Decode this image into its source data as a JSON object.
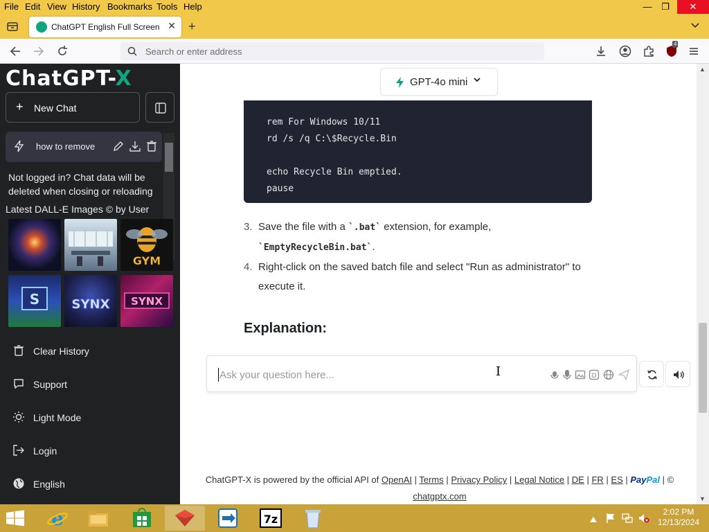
{
  "menubar": {
    "items": [
      "File",
      "Edit",
      "View",
      "History",
      "Bookmarks",
      "Tools",
      "Help"
    ],
    "window_controls": {
      "minimize": "—",
      "restore": "❐",
      "close": "✕"
    }
  },
  "tabbar": {
    "active_tab_title": "ChatGPT English Full Screen | X",
    "new_tab_label": "+"
  },
  "navbar": {
    "address_placeholder": "Search or enter address",
    "extension_badge": "4"
  },
  "sidebar": {
    "logo_main": "ChatGPT-",
    "logo_accent": "X",
    "new_chat_label": "New Chat",
    "chat_items": [
      {
        "title": "how to remove"
      }
    ],
    "notice": "Not logged in? Chat data will be deleted when closing or reloading",
    "dalle_title": "Latest DALL-E Images © by User",
    "images": [
      "planet-explosion",
      "gym-interior",
      "gym-bee-logo",
      "synx-logo-1",
      "synx-logo-2",
      "synx-banner"
    ],
    "gym_text": "GYM",
    "synx_text": "SYNX",
    "links": [
      {
        "label": "Clear History",
        "icon": "trash-icon"
      },
      {
        "label": "Support",
        "icon": "chat-bubble-icon"
      },
      {
        "label": "Light Mode",
        "icon": "sun-icon"
      },
      {
        "label": "Login",
        "icon": "login-icon"
      },
      {
        "label": "English",
        "icon": "globe-icon"
      }
    ]
  },
  "main": {
    "model_label": "GPT-4o mini",
    "code_lines": "rem For Windows 10/11\nrd /s /q C:\\$Recycle.Bin\n\necho Recycle Bin emptied.\npause",
    "steps": [
      {
        "num": "3.",
        "pre": "Save the file with a ",
        "code1": "`.bat`",
        "mid": " extension, for example, ",
        "code2": "`EmptyRecycleBin.bat`",
        "post": "."
      },
      {
        "num": "4.",
        "text": "Right-click on the saved batch file and select \"Run as administrator\" to execute it."
      }
    ],
    "heading": "Explanation:",
    "input_placeholder": "Ask your question here..."
  },
  "footer": {
    "prefix": "ChatGPT-X is powered by the official API of ",
    "links": [
      "OpenAI",
      "Terms",
      "Privacy Policy",
      "Legal Notice",
      "DE",
      "FR",
      "ES"
    ],
    "separator": " | ",
    "paypal_a": "Pay",
    "paypal_b": "Pal",
    "copyright": " | ©",
    "domain": "chatgptx.com"
  },
  "taskbar": {
    "apps": [
      "internet-explorer",
      "file-explorer",
      "store",
      "app-red",
      "file-transfer",
      "7-zip",
      "recycle-bin"
    ],
    "seven_zip_label": "7z",
    "time": "2:02 PM",
    "date": "12/13/2024"
  },
  "colors": {
    "accent_green": "#10a37f",
    "sidebar_bg": "#202123",
    "firefox_chrome": "#f2c84b",
    "taskbar": "#c9a33a"
  }
}
